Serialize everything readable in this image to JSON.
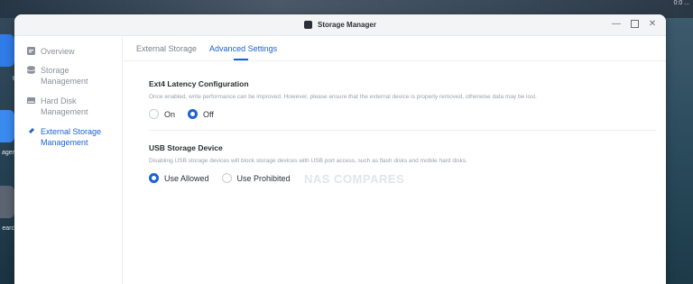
{
  "window": {
    "title": "Storage Manager"
  },
  "tray": {
    "text": "0:0  ..."
  },
  "desktop": {
    "labels": [
      "t",
      "ager",
      "earc"
    ]
  },
  "sidebar": {
    "items": [
      {
        "label": "Overview",
        "icon": "overview-icon",
        "active": false
      },
      {
        "label": "Storage\nManagement",
        "icon": "stack-icon",
        "active": false
      },
      {
        "label": "Hard Disk\nManagement",
        "icon": "harddisk-icon",
        "active": false
      },
      {
        "label": "External Storage\nManagement",
        "icon": "usb-icon",
        "active": true
      }
    ]
  },
  "tabs": [
    {
      "label": "External Storage",
      "active": false
    },
    {
      "label": "Advanced Settings",
      "active": true
    }
  ],
  "ext4": {
    "title": "Ext4 Latency Configuration",
    "description": "Once enabled, write performance can be improved. However, please ensure that the external device is properly removed, otherwise data may be lost.",
    "options": [
      {
        "label": "On",
        "checked": false
      },
      {
        "label": "Off",
        "checked": true
      }
    ]
  },
  "usb": {
    "title": "USB Storage Device",
    "description": "Disabling USB storage devices will block storage devices with USB port access, such as flash disks and mobile hard disks.",
    "options": [
      {
        "label": "Use Allowed",
        "checked": true
      },
      {
        "label": "Use Prohibited",
        "checked": false
      }
    ]
  },
  "watermark": "NAS COMPARES",
  "colors": {
    "accent": "#1a62d6",
    "muted_text": "#8a9099"
  }
}
